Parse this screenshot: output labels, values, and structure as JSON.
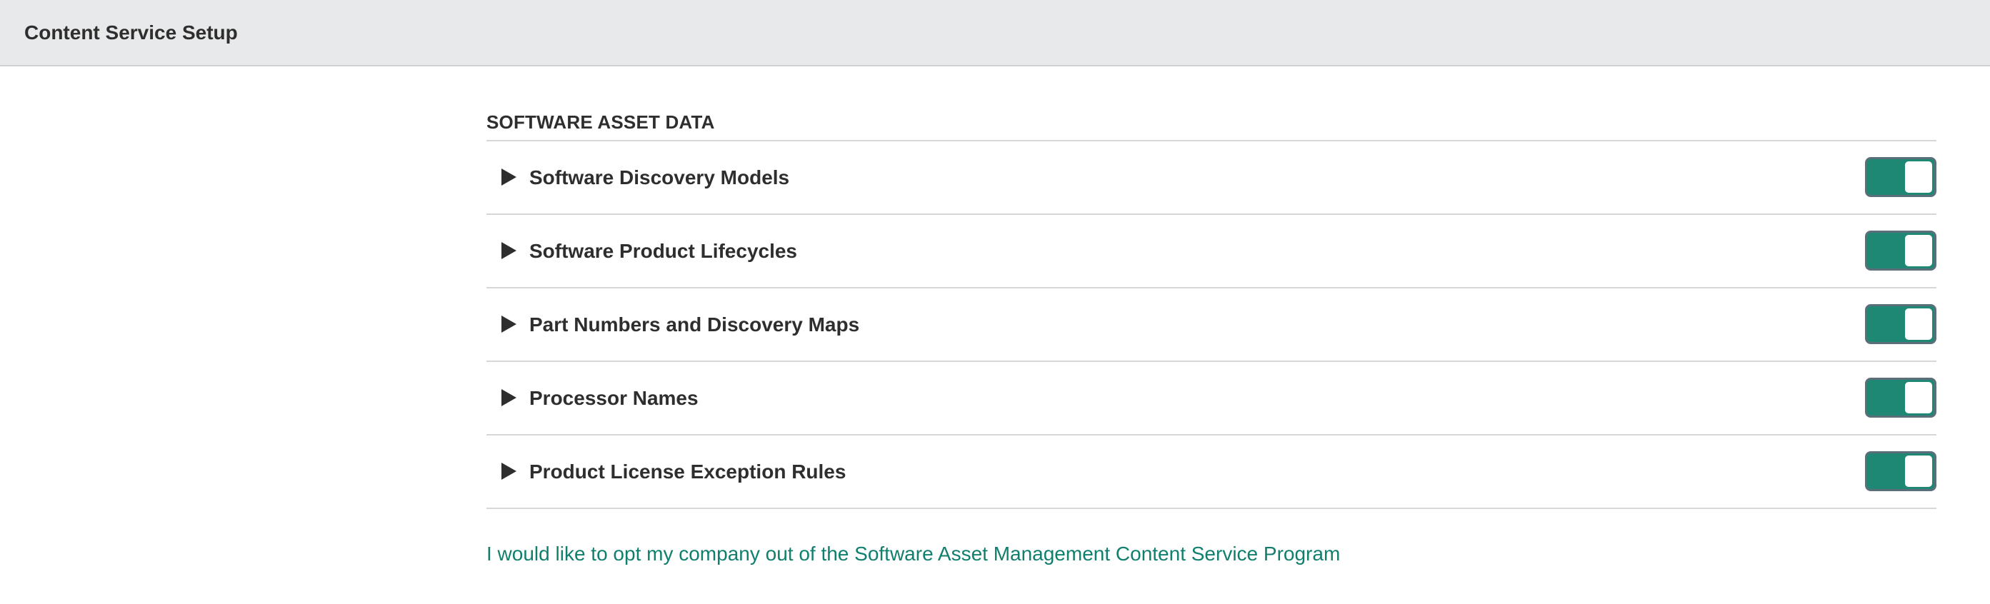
{
  "header": {
    "title": "Content Service Setup"
  },
  "section": {
    "heading": "SOFTWARE ASSET DATA",
    "items": [
      {
        "label": "Software Discovery Models",
        "enabled": true
      },
      {
        "label": "Software Product Lifecycles",
        "enabled": true
      },
      {
        "label": "Part Numbers and Discovery Maps",
        "enabled": true
      },
      {
        "label": "Processor Names",
        "enabled": true
      },
      {
        "label": "Product License Exception Rules",
        "enabled": true
      }
    ]
  },
  "opt_out": {
    "link_text": "I would like to opt my company out of the Software Asset Management Content Service Program"
  },
  "colors": {
    "accent": "#1f8874",
    "link": "#117f6d",
    "header_bg": "#e8e9ea"
  },
  "icons": {
    "expand": "caret-right-icon"
  }
}
